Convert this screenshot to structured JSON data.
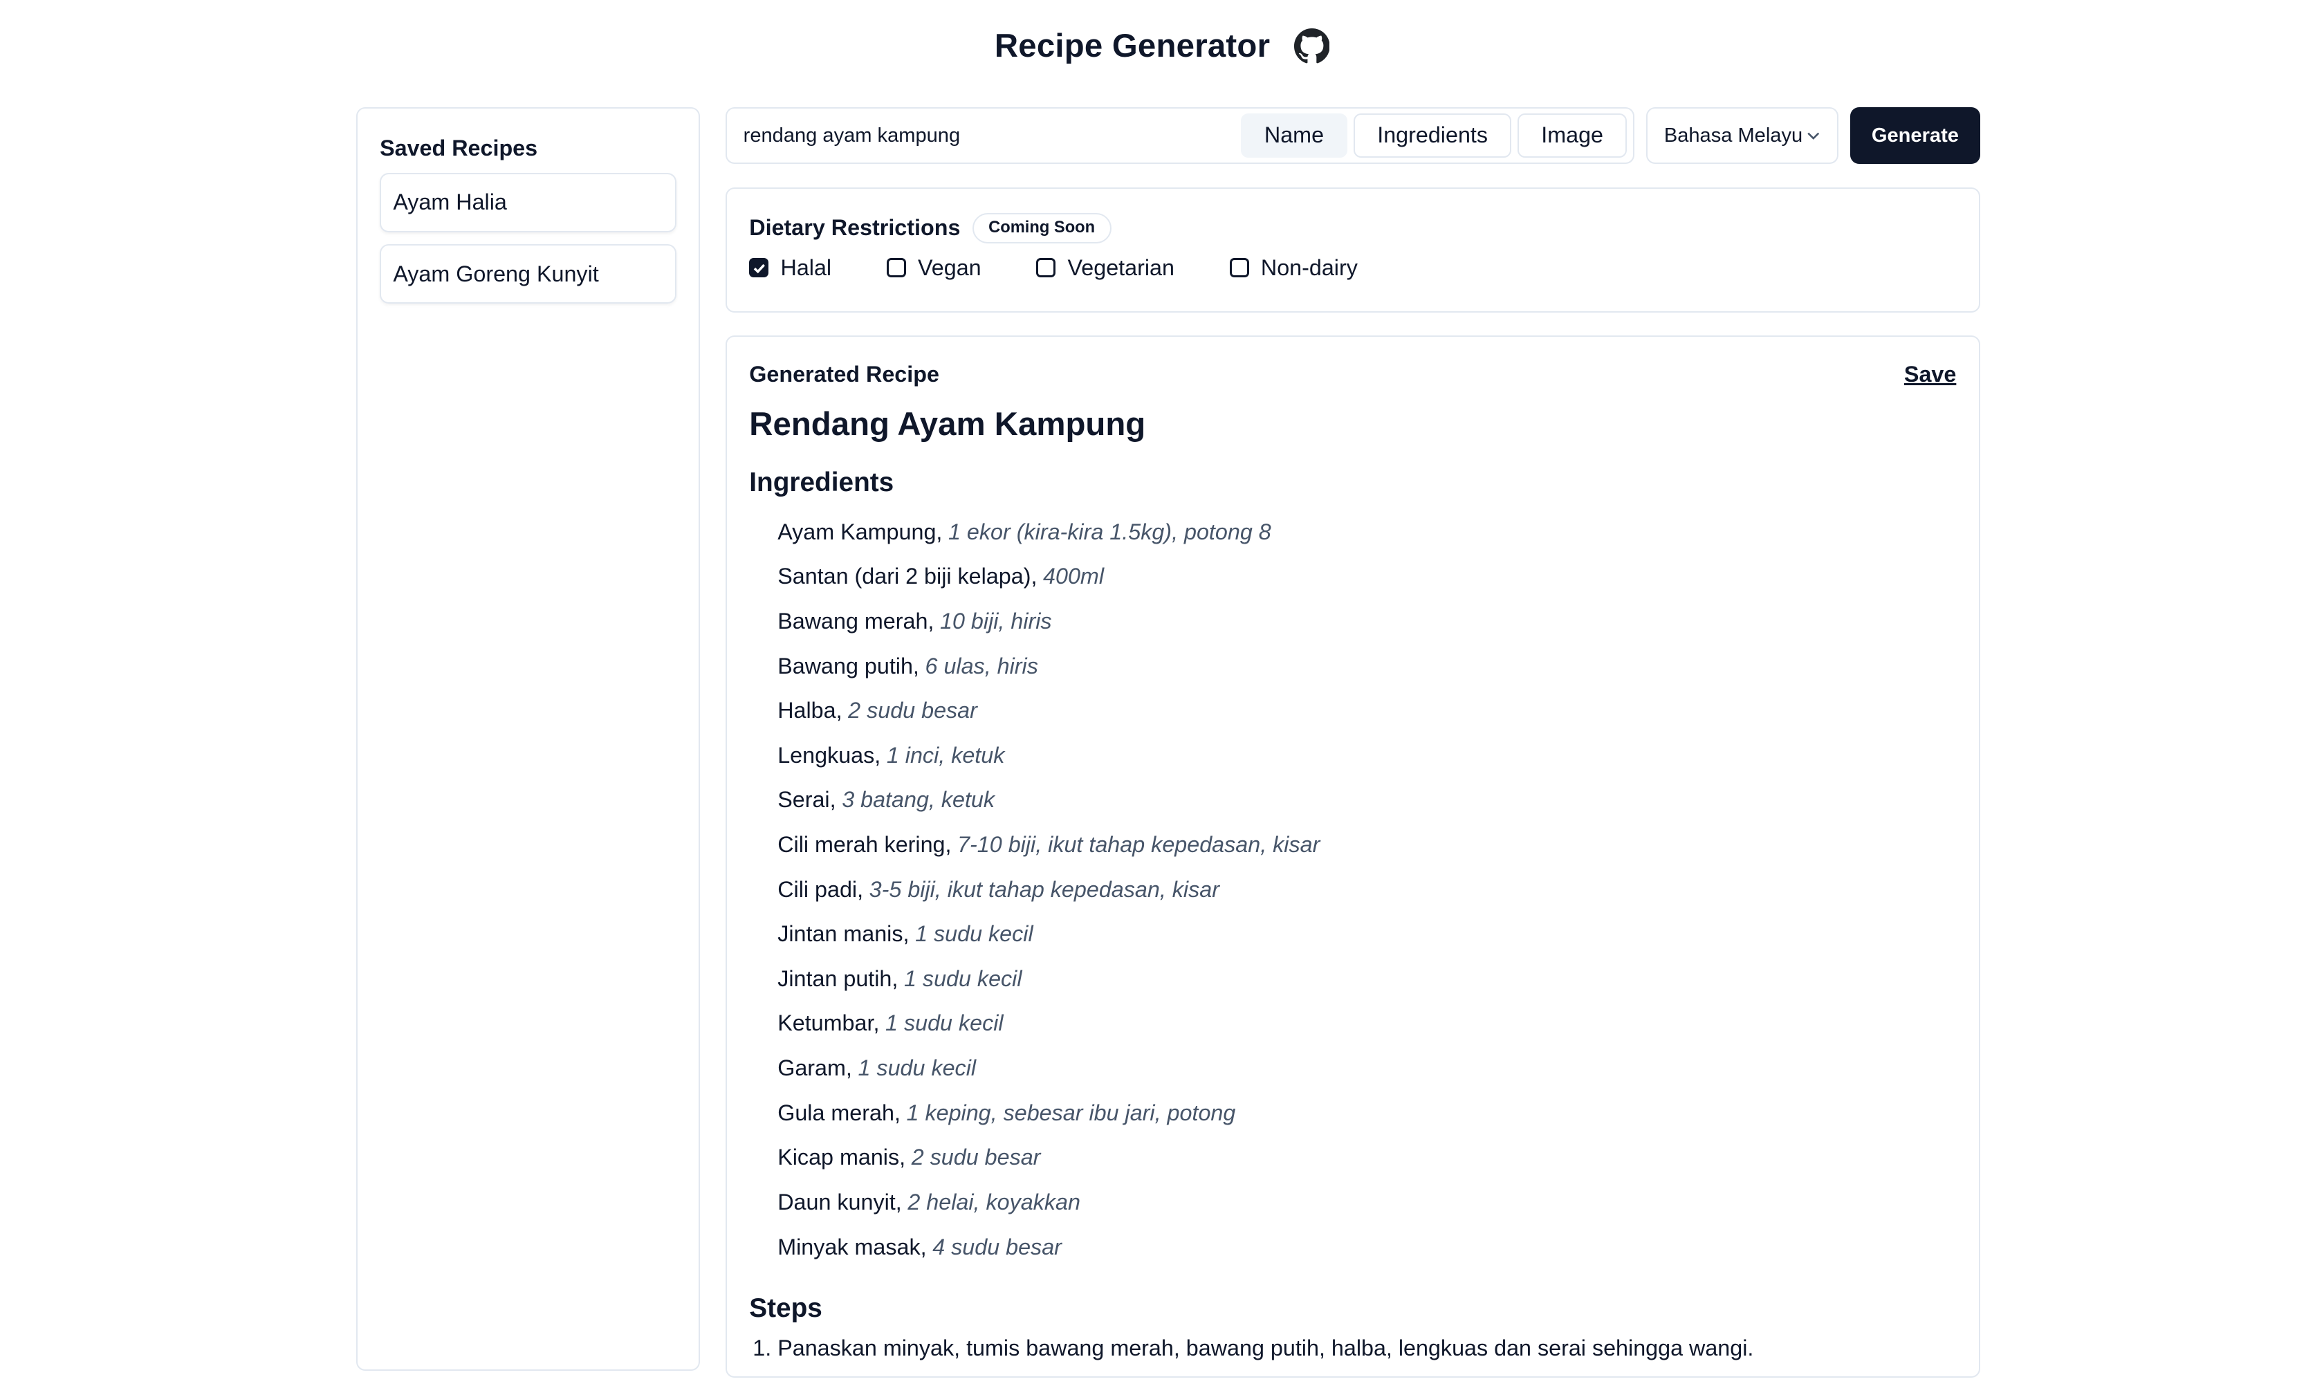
{
  "header": {
    "title": "Recipe Generator",
    "github_icon": "github-icon"
  },
  "sidebar": {
    "title": "Saved Recipes",
    "items": [
      {
        "label": "Ayam Halia"
      },
      {
        "label": "Ayam Goreng Kunyit"
      }
    ]
  },
  "search": {
    "value": "rendang ayam kampung",
    "modes": [
      {
        "label": "Name",
        "active": true
      },
      {
        "label": "Ingredients"
      },
      {
        "label": "Image"
      }
    ],
    "language": "Bahasa Melayu",
    "generate_label": "Generate"
  },
  "dietary": {
    "title": "Dietary Restrictions",
    "badge": "Coming Soon",
    "options": [
      {
        "label": "Halal",
        "checked": true
      },
      {
        "label": "Vegan",
        "checked": false
      },
      {
        "label": "Vegetarian",
        "checked": false
      },
      {
        "label": "Non-dairy",
        "checked": false
      }
    ]
  },
  "recipe": {
    "label": "Generated Recipe",
    "save_label": "Save",
    "name": "Rendang Ayam Kampung",
    "ingredients_heading": "Ingredients",
    "ingredients": [
      {
        "name": "Ayam Kampung,",
        "qty": "1 ekor (kira-kira 1.5kg), potong 8"
      },
      {
        "name": "Santan (dari 2 biji kelapa),",
        "qty": "400ml"
      },
      {
        "name": "Bawang merah,",
        "qty": "10 biji, hiris"
      },
      {
        "name": "Bawang putih,",
        "qty": "6 ulas, hiris"
      },
      {
        "name": "Halba,",
        "qty": "2 sudu besar"
      },
      {
        "name": "Lengkuas,",
        "qty": "1 inci, ketuk"
      },
      {
        "name": "Serai,",
        "qty": "3 batang, ketuk"
      },
      {
        "name": "Cili merah kering,",
        "qty": "7-10 biji, ikut tahap kepedasan, kisar"
      },
      {
        "name": "Cili padi,",
        "qty": "3-5 biji, ikut tahap kepedasan, kisar"
      },
      {
        "name": "Jintan manis,",
        "qty": "1 sudu kecil"
      },
      {
        "name": "Jintan putih,",
        "qty": "1 sudu kecil"
      },
      {
        "name": "Ketumbar,",
        "qty": "1 sudu kecil"
      },
      {
        "name": "Garam,",
        "qty": "1 sudu kecil"
      },
      {
        "name": "Gula merah,",
        "qty": "1 keping, sebesar ibu jari, potong"
      },
      {
        "name": "Kicap manis,",
        "qty": "2 sudu besar"
      },
      {
        "name": "Daun kunyit,",
        "qty": "2 helai, koyakkan"
      },
      {
        "name": "Minyak masak,",
        "qty": "4 sudu besar"
      }
    ],
    "steps_heading": "Steps",
    "steps": [
      "Panaskan minyak, tumis bawang merah, bawang putih, halba, lengkuas dan serai sehingga wangi."
    ]
  }
}
